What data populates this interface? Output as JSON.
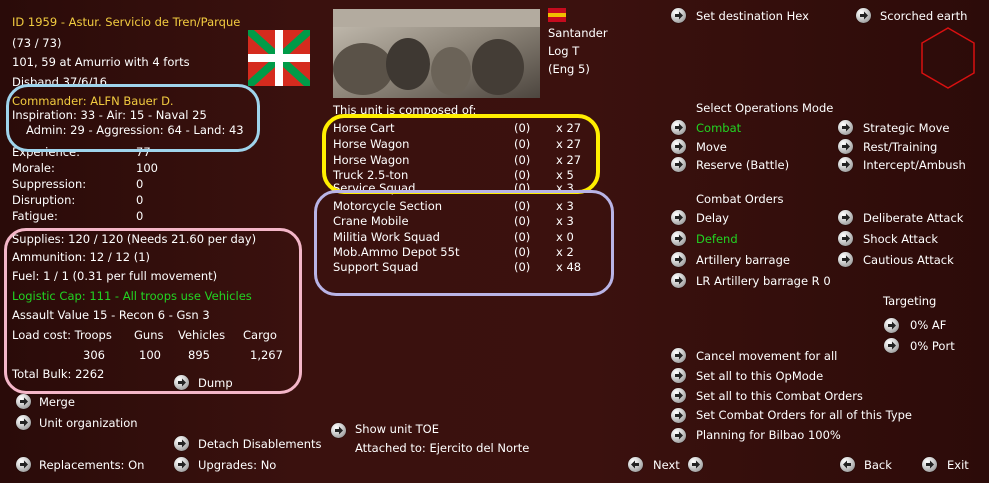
{
  "unit": {
    "id_line": "ID 1959 - Astur. Servicio de Tren/Parque",
    "strength": "(73 / 73)",
    "location": "101, 59 at Amurrio with 4 forts",
    "disband": "Disband 37/6/16"
  },
  "commander": {
    "name": "Commander: ALFN Bauer D.",
    "line1": "Inspiration: 33 - Air: 15 - Naval 25",
    "line2": "Admin: 29 - Aggression: 64 - Land: 43"
  },
  "stats": [
    {
      "label": "Experience:",
      "value": "77"
    },
    {
      "label": "Morale:",
      "value": "100"
    },
    {
      "label": "Suppression:",
      "value": "0"
    },
    {
      "label": "Disruption:",
      "value": "0"
    },
    {
      "label": "Fatigue:",
      "value": "0"
    }
  ],
  "supply": {
    "supplies": "Supplies: 120 / 120 (Needs 21.60 per day)",
    "ammunition": "Ammunition: 12 / 12 (1)",
    "fuel": "Fuel: 1 / 1 (0.31 per full movement)",
    "logistic": "Logistic Cap: 111 - All troops use Vehicles",
    "assault": "Assault Value 15 - Recon 6 - Gsn 3",
    "load_headers": [
      "Load cost: Troops",
      "Guns",
      "Vehicles",
      "Cargo"
    ],
    "load_values": [
      "306",
      "100",
      "895",
      "1,267"
    ],
    "total_bulk": "Total Bulk: 2262"
  },
  "buttons_left": {
    "dump": "Dump",
    "merge": "Merge",
    "unit_org": "Unit organization",
    "detach": "Detach Disablements",
    "replacements": "Replacements: On",
    "upgrades": "Upgrades: No"
  },
  "hq": {
    "name": "Santander",
    "log": "Log T",
    "eng": "(Eng 5)"
  },
  "composition": {
    "header": "This unit is composed of:",
    "items": [
      {
        "name": "Horse Cart",
        "dmg": "(0)",
        "qty": "x 27"
      },
      {
        "name": "Horse Wagon",
        "dmg": "(0)",
        "qty": "x 27"
      },
      {
        "name": "Horse Wagon",
        "dmg": "(0)",
        "qty": "x 27"
      },
      {
        "name": "Truck 2.5-ton",
        "dmg": "(0)",
        "qty": "x 5"
      },
      {
        "name": "Service Squad",
        "dmg": "(0)",
        "qty": "x 3"
      },
      {
        "name": "Motorcycle Section",
        "dmg": "(0)",
        "qty": "x 3"
      },
      {
        "name": "Crane Mobile",
        "dmg": "(0)",
        "qty": "x 3"
      },
      {
        "name": "Militia Work Squad",
        "dmg": "(0)",
        "qty": "x 0"
      },
      {
        "name": "Mob.Ammo Depot 55t",
        "dmg": "(0)",
        "qty": "x 2"
      },
      {
        "name": "Support Squad",
        "dmg": "(0)",
        "qty": "x 48"
      }
    ]
  },
  "middle_bottom": {
    "show_toe": "Show unit TOE",
    "attached": "Attached to: Ejercito del Norte",
    "next": "Next"
  },
  "right": {
    "set_dest": "Set destination Hex",
    "scorched": "Scorched earth",
    "ops_title": "Select Operations Mode",
    "ops": [
      {
        "label": "Combat",
        "active": true
      },
      {
        "label": "Strategic Move",
        "active": false
      },
      {
        "label": "Move",
        "active": false
      },
      {
        "label": "Rest/Training",
        "active": false
      },
      {
        "label": "Reserve (Battle)",
        "active": false
      },
      {
        "label": "Intercept/Ambush",
        "active": false
      }
    ],
    "orders_title": "Combat Orders",
    "orders": [
      {
        "label": "Delay",
        "active": false
      },
      {
        "label": "Deliberate Attack",
        "active": false
      },
      {
        "label": "Defend",
        "active": true
      },
      {
        "label": "Shock Attack",
        "active": false
      },
      {
        "label": "Artillery barrage",
        "active": false
      },
      {
        "label": "Cautious Attack",
        "active": false
      }
    ],
    "lr_artillery": "LR Artillery barrage R 0",
    "targeting_title": "Targeting",
    "af": "0% AF",
    "port": "0% Port",
    "cancel": "Cancel movement for all",
    "set_opmode": "Set all to this OpMode",
    "set_orders": "Set all to this Combat Orders",
    "set_type": "Set Combat Orders for all of this Type",
    "planning": "Planning for Bilbao 100%",
    "back": "Back",
    "exit": "Exit"
  },
  "colors": {
    "background": "#3a110e",
    "header_yellow": "#f2cc40",
    "active_green": "#22d422",
    "oval_blue": "#9fd4ec",
    "oval_pink": "#f4b6c8",
    "oval_yellow": "#ffee00",
    "oval_lavender": "#b9b4e6",
    "hex_red": "#d81010"
  },
  "icons": [
    "arrow-right-icon",
    "arrow-left-icon",
    "hex-icon",
    "basque-flag-icon",
    "spanish-flag-icon"
  ]
}
